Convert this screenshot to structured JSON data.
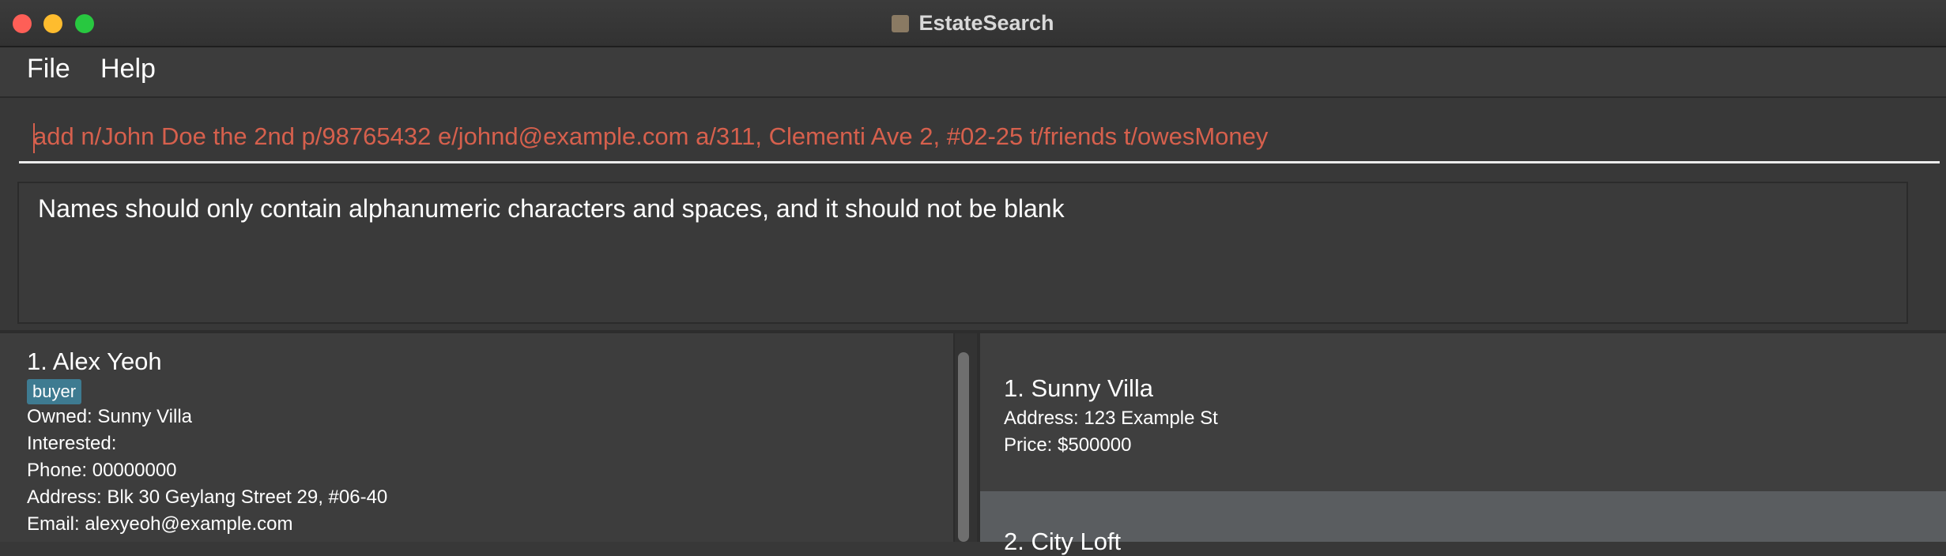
{
  "window": {
    "title": "EstateSearch"
  },
  "menu": {
    "file": "File",
    "help": "Help"
  },
  "command": {
    "value": "add n/John Doe the 2nd p/98765432 e/johnd@example.com a/311, Clementi Ave 2, #02-25 t/friends t/owesMoney"
  },
  "result": {
    "message": "Names should only contain alphanumeric characters and spaces, and it should not be blank"
  },
  "persons": [
    {
      "name": "1.  Alex Yeoh",
      "tag": "buyer",
      "owned": "Owned:  Sunny Villa",
      "interested": "Interested:",
      "phone": "Phone:  00000000",
      "address": "Address:  Blk 30 Geylang Street 29, #06-40",
      "email": "Email:  alexyeoh@example.com"
    }
  ],
  "properties": [
    {
      "name": "1.  Sunny Villa",
      "address": "Address: 123 Example St",
      "price": "Price: $500000"
    },
    {
      "name": "2.  City Loft"
    }
  ]
}
